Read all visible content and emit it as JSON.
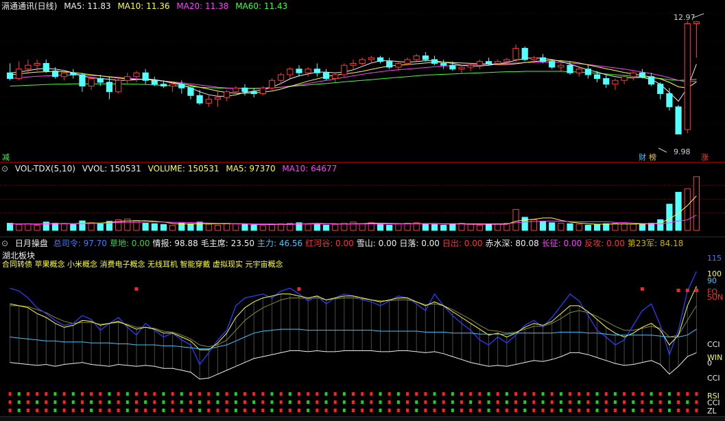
{
  "title_bar": {
    "stock": "滆通通讯(日线)",
    "ma5": "MA5: 11.83",
    "ma10": "MA10: 11.36",
    "ma20": "MA20: 11.38",
    "ma60": "MA60: 11.43"
  },
  "price_panel": {
    "high_label": "12.97",
    "low_label": "9.98",
    "left_marker": "减",
    "marker_cai": "财",
    "marker_bang": "榜",
    "marker_zhang": "涨"
  },
  "volume_panel": {
    "indicator": "VOL-TDX(5,10)",
    "vvol": "VVOL: 150531",
    "volume": "VOLUME: 150531",
    "ma5": "MA5: 97370",
    "ma10": "MA10: 64677"
  },
  "indicator_panel": {
    "name": "日月操盘",
    "fields": [
      {
        "text": "总司令: 97.70",
        "color": "#3f7fff"
      },
      {
        "text": "草地: 0.00",
        "color": "#3fd13f"
      },
      {
        "text": "情报: 98.88",
        "color": "#f0f0f0"
      },
      {
        "text": "毛主席: 23.50",
        "color": "#f0f0f0"
      },
      {
        "text": "主力: 46.56",
        "color": "#40c8ff"
      },
      {
        "text": "红河谷: 0.00",
        "color": "#ff3030"
      },
      {
        "text": "雪山: 0.00",
        "color": "#f0f0f0"
      },
      {
        "text": "日落: 0.00",
        "color": "#f0f0f0"
      },
      {
        "text": "日出: 0.00",
        "color": "#ff3030"
      },
      {
        "text": "赤水深: 80.08",
        "color": "#f0f0f0"
      },
      {
        "text": "长征: 0.00",
        "color": "#ff40ff"
      },
      {
        "text": "反攻: 0.00",
        "color": "#ff3030"
      },
      {
        "text": "第23军: 84.18",
        "color": "#c8b400"
      }
    ],
    "sector": "湖北板块",
    "concepts": "合同转债 苹果概念 小米概念 消费电子概念 无线耳机 智能穿戴 虚拟现实 元宇宙概念",
    "right_labels": [
      {
        "text": "115",
        "color": "#3f7fff"
      },
      {
        "text": "100",
        "color": "#ffff40"
      },
      {
        "text": "90",
        "color": "#40c8ff"
      },
      {
        "text": "FQ",
        "color": "#ff3030"
      },
      {
        "text": "SUN",
        "color": "#ff3030"
      },
      {
        "text": "CCI",
        "color": "#f0f0f0"
      },
      {
        "text": "WIN",
        "color": "#ffff40"
      },
      {
        "text": "0",
        "color": "#f0f0f0"
      },
      {
        "text": "CCI",
        "color": "#f0f0f0"
      },
      {
        "text": "RSI",
        "color": "#ffff40"
      },
      {
        "text": "CCI",
        "color": "#f0f0f0"
      },
      {
        "text": "ZL",
        "color": "#f0f0f0"
      }
    ]
  },
  "colors": {
    "up": "#ff3c3c",
    "down": "#54ffff",
    "ma5": "#f0f0f0",
    "ma10": "#ffff40",
    "ma20": "#ff40ff",
    "ma60": "#40ff40",
    "grid": "#8b0000"
  },
  "chart_data": {
    "type": "candlestick",
    "y_range_price": [
      9.5,
      13.2
    ],
    "ohlc": [
      [
        11.6,
        11.85,
        11.45,
        11.4
      ],
      [
        11.45,
        11.9,
        11.7,
        11.4
      ],
      [
        11.7,
        11.95,
        11.8,
        11.6
      ],
      [
        11.8,
        11.95,
        11.85,
        11.65
      ],
      [
        11.85,
        11.95,
        11.65,
        11.6
      ],
      [
        11.65,
        11.75,
        11.5,
        11.45
      ],
      [
        11.5,
        11.65,
        11.6,
        11.4
      ],
      [
        11.6,
        11.7,
        11.55,
        11.45
      ],
      [
        11.55,
        11.6,
        11.25,
        11.1
      ],
      [
        11.25,
        11.5,
        11.45,
        11.15
      ],
      [
        11.45,
        11.55,
        11.35,
        11.25
      ],
      [
        11.35,
        11.5,
        11.1,
        10.9
      ],
      [
        11.1,
        11.5,
        11.4,
        11.05
      ],
      [
        11.4,
        11.6,
        11.5,
        11.3
      ],
      [
        11.5,
        11.65,
        11.6,
        11.35
      ],
      [
        11.6,
        11.7,
        11.4,
        11.3
      ],
      [
        11.4,
        11.5,
        11.3,
        11.25
      ],
      [
        11.3,
        11.4,
        11.25,
        11.2
      ],
      [
        11.25,
        11.35,
        11.3,
        11.1
      ],
      [
        11.3,
        11.4,
        11.2,
        11.05
      ],
      [
        11.2,
        11.25,
        11.0,
        10.9
      ],
      [
        11.0,
        11.15,
        10.8,
        10.75
      ],
      [
        10.8,
        11.0,
        10.9,
        10.7
      ],
      [
        10.9,
        11.1,
        10.95,
        10.7
      ],
      [
        10.95,
        11.15,
        11.1,
        10.85
      ],
      [
        11.1,
        11.25,
        11.2,
        11.05
      ],
      [
        11.2,
        11.3,
        11.1,
        11.0
      ],
      [
        11.1,
        11.2,
        11.05,
        10.95
      ],
      [
        11.05,
        11.25,
        11.2,
        11.0
      ],
      [
        11.2,
        11.45,
        11.4,
        11.15
      ],
      [
        11.4,
        11.6,
        11.55,
        11.3
      ],
      [
        11.55,
        11.75,
        11.7,
        11.45
      ],
      [
        11.7,
        11.8,
        11.6,
        11.5
      ],
      [
        11.6,
        11.75,
        11.7,
        11.5
      ],
      [
        11.7,
        11.85,
        11.6,
        11.5
      ],
      [
        11.6,
        11.7,
        11.45,
        11.4
      ],
      [
        11.45,
        11.6,
        11.55,
        11.35
      ],
      [
        11.55,
        11.85,
        11.8,
        11.5
      ],
      [
        11.8,
        11.95,
        11.85,
        11.7
      ],
      [
        11.85,
        12.0,
        11.95,
        11.8
      ],
      [
        11.95,
        12.05,
        12.0,
        11.85
      ],
      [
        12.0,
        12.05,
        11.9,
        11.85
      ],
      [
        11.9,
        12.0,
        11.75,
        11.7
      ],
      [
        11.75,
        11.9,
        11.85,
        11.65
      ],
      [
        11.85,
        12.0,
        11.95,
        11.8
      ],
      [
        11.95,
        12.1,
        12.05,
        11.9
      ],
      [
        12.05,
        12.15,
        11.95,
        11.9
      ],
      [
        11.95,
        12.05,
        11.85,
        11.8
      ],
      [
        11.85,
        11.95,
        11.8,
        11.7
      ],
      [
        11.8,
        11.9,
        11.7,
        11.65
      ],
      [
        11.7,
        11.8,
        11.75,
        11.6
      ],
      [
        11.75,
        11.85,
        11.8,
        11.65
      ],
      [
        11.8,
        11.95,
        11.9,
        11.7
      ],
      [
        11.9,
        12.0,
        11.85,
        11.8
      ],
      [
        11.85,
        11.95,
        11.9,
        11.8
      ],
      [
        11.9,
        12.0,
        11.95,
        11.8
      ],
      [
        11.95,
        12.35,
        12.25,
        11.9
      ],
      [
        12.25,
        12.3,
        11.95,
        11.9
      ],
      [
        11.95,
        12.05,
        12.0,
        11.85
      ],
      [
        12.0,
        12.1,
        11.9,
        11.85
      ],
      [
        11.9,
        11.95,
        11.75,
        11.7
      ],
      [
        11.75,
        11.85,
        11.8,
        11.65
      ],
      [
        11.8,
        11.9,
        11.6,
        11.55
      ],
      [
        11.6,
        11.75,
        11.7,
        11.5
      ],
      [
        11.7,
        11.8,
        11.55,
        11.45
      ],
      [
        11.55,
        11.65,
        11.45,
        11.35
      ],
      [
        11.45,
        11.55,
        11.3,
        11.2
      ],
      [
        11.3,
        11.45,
        11.4,
        11.15
      ],
      [
        11.4,
        11.55,
        11.5,
        11.3
      ],
      [
        11.5,
        11.65,
        11.6,
        11.4
      ],
      [
        11.6,
        11.7,
        11.5,
        11.45
      ],
      [
        11.5,
        11.6,
        11.3,
        11.25
      ],
      [
        11.3,
        11.35,
        11.05,
        10.9
      ],
      [
        11.05,
        11.2,
        10.7,
        10.6
      ],
      [
        10.7,
        10.75,
        9.98,
        9.98
      ],
      [
        10.1,
        12.97,
        12.9,
        10.0
      ],
      [
        12.9,
        12.97,
        12.95,
        12.0
      ]
    ],
    "ma5_line": [
      11.6,
      11.62,
      11.66,
      11.7,
      11.72,
      11.7,
      11.66,
      11.6,
      11.52,
      11.47,
      11.45,
      11.43,
      11.4,
      11.4,
      11.42,
      11.44,
      11.42,
      11.38,
      11.33,
      11.28,
      11.2,
      11.1,
      11.02,
      10.98,
      10.98,
      11.02,
      11.08,
      11.12,
      11.15,
      11.22,
      11.32,
      11.44,
      11.52,
      11.57,
      11.62,
      11.62,
      11.6,
      11.62,
      11.68,
      11.77,
      11.86,
      11.92,
      11.92,
      11.9,
      11.88,
      11.9,
      11.92,
      11.92,
      11.88,
      11.85,
      11.8,
      11.78,
      11.78,
      11.8,
      11.84,
      11.87,
      11.93,
      11.98,
      12.0,
      11.98,
      11.95,
      11.9,
      11.83,
      11.75,
      11.68,
      11.62,
      11.55,
      11.5,
      11.47,
      11.47,
      11.48,
      11.42,
      11.3,
      11.08,
      10.85,
      11.2,
      11.83
    ],
    "ma10_line": [
      11.55,
      11.57,
      11.6,
      11.62,
      11.63,
      11.64,
      11.63,
      11.61,
      11.58,
      11.55,
      11.52,
      11.49,
      11.46,
      11.44,
      11.43,
      11.43,
      11.41,
      11.38,
      11.35,
      11.31,
      11.27,
      11.22,
      11.17,
      11.12,
      11.08,
      11.06,
      11.06,
      11.07,
      11.09,
      11.12,
      11.17,
      11.24,
      11.31,
      11.38,
      11.44,
      11.5,
      11.54,
      11.57,
      11.6,
      11.64,
      11.69,
      11.74,
      11.78,
      11.8,
      11.82,
      11.84,
      11.86,
      11.88,
      11.88,
      11.87,
      11.86,
      11.85,
      11.84,
      11.83,
      11.82,
      11.82,
      11.84,
      11.87,
      11.9,
      11.92,
      11.93,
      11.92,
      11.9,
      11.86,
      11.81,
      11.76,
      11.71,
      11.66,
      11.61,
      11.57,
      11.53,
      11.49,
      11.44,
      11.35,
      11.23,
      11.2,
      11.36
    ],
    "ma20_line": [
      11.45,
      11.47,
      11.49,
      11.51,
      11.52,
      11.53,
      11.54,
      11.54,
      11.54,
      11.53,
      11.52,
      11.5,
      11.48,
      11.46,
      11.44,
      11.42,
      11.4,
      11.38,
      11.36,
      11.34,
      11.31,
      11.28,
      11.25,
      11.22,
      11.2,
      11.19,
      11.18,
      11.18,
      11.19,
      11.2,
      11.22,
      11.25,
      11.28,
      11.32,
      11.36,
      11.4,
      11.44,
      11.48,
      11.52,
      11.56,
      11.6,
      11.63,
      11.66,
      11.68,
      11.7,
      11.72,
      11.74,
      11.76,
      11.78,
      11.79,
      11.8,
      11.81,
      11.82,
      11.83,
      11.84,
      11.85,
      11.86,
      11.87,
      11.88,
      11.88,
      11.88,
      11.87,
      11.86,
      11.84,
      11.82,
      11.79,
      11.76,
      11.73,
      11.7,
      11.66,
      11.62,
      11.58,
      11.53,
      11.47,
      11.4,
      11.36,
      11.38
    ],
    "ma60_line": [
      11.25,
      11.26,
      11.27,
      11.28,
      11.29,
      11.3,
      11.3,
      11.31,
      11.31,
      11.31,
      11.31,
      11.31,
      11.31,
      11.3,
      11.3,
      11.29,
      11.28,
      11.27,
      11.26,
      11.25,
      11.24,
      11.22,
      11.21,
      11.2,
      11.19,
      11.19,
      11.19,
      11.19,
      11.2,
      11.21,
      11.22,
      11.24,
      11.26,
      11.28,
      11.3,
      11.32,
      11.34,
      11.36,
      11.38,
      11.4,
      11.42,
      11.44,
      11.46,
      11.48,
      11.5,
      11.52,
      11.54,
      11.55,
      11.56,
      11.57,
      11.58,
      11.59,
      11.6,
      11.61,
      11.62,
      11.63,
      11.63,
      11.64,
      11.64,
      11.64,
      11.64,
      11.64,
      11.63,
      11.62,
      11.61,
      11.59,
      11.57,
      11.55,
      11.53,
      11.51,
      11.49,
      11.47,
      11.45,
      11.42,
      11.4,
      11.41,
      11.43
    ],
    "volume": [
      30,
      25,
      28,
      22,
      35,
      30,
      28,
      25,
      40,
      32,
      28,
      38,
      45,
      48,
      42,
      30,
      28,
      25,
      22,
      30,
      28,
      35,
      26,
      22,
      30,
      28,
      25,
      22,
      20,
      25,
      28,
      30,
      32,
      26,
      28,
      22,
      25,
      30,
      35,
      28,
      32,
      26,
      22,
      28,
      30,
      32,
      28,
      25,
      22,
      28,
      30,
      26,
      22,
      24,
      26,
      30,
      88,
      55,
      45,
      38,
      32,
      30,
      28,
      26,
      22,
      25,
      28,
      30,
      28,
      26,
      25,
      30,
      45,
      110,
      160,
      175,
      225
    ],
    "vol_ma5_line": [
      28,
      27,
      27,
      26,
      28,
      28,
      29,
      28,
      31,
      31,
      31,
      33,
      37,
      40,
      40,
      41,
      38,
      35,
      29,
      27,
      27,
      28,
      28,
      28,
      28,
      28,
      28,
      25,
      25,
      25,
      25,
      25,
      27,
      28,
      29,
      28,
      28,
      26,
      28,
      28,
      30,
      30,
      29,
      28,
      28,
      28,
      28,
      29,
      27,
      27,
      27,
      26,
      26,
      26,
      26,
      26,
      38,
      44,
      47,
      52,
      52,
      42,
      35,
      31,
      28,
      26,
      26,
      27,
      27,
      27,
      27,
      28,
      31,
      48,
      72,
      104,
      145
    ],
    "vol_ma10_line": [
      27,
      27,
      27,
      27,
      27,
      28,
      28,
      28,
      29,
      29,
      30,
      31,
      33,
      34,
      34,
      35,
      35,
      35,
      34,
      34,
      33,
      32,
      31,
      30,
      30,
      28,
      28,
      27,
      27,
      27,
      26,
      27,
      27,
      27,
      27,
      27,
      27,
      26,
      27,
      27,
      27,
      27,
      27,
      27,
      28,
      28,
      28,
      28,
      28,
      28,
      28,
      28,
      28,
      28,
      28,
      28,
      32,
      35,
      37,
      39,
      39,
      38,
      37,
      36,
      36,
      36,
      36,
      34,
      33,
      31,
      29,
      28,
      28,
      32,
      39,
      44,
      64
    ],
    "ind_blue": [
      98,
      95,
      88,
      78,
      72,
      65,
      60,
      62,
      70,
      66,
      55,
      62,
      68,
      58,
      50,
      62,
      55,
      48,
      52,
      45,
      40,
      20,
      32,
      45,
      55,
      80,
      88,
      90,
      92,
      88,
      95,
      98,
      92,
      85,
      90,
      82,
      88,
      92,
      90,
      86,
      84,
      80,
      85,
      90,
      88,
      82,
      75,
      92,
      80,
      70,
      62,
      55,
      45,
      40,
      48,
      42,
      50,
      60,
      65,
      58,
      68,
      80,
      92,
      85,
      70,
      55,
      48,
      40,
      45,
      60,
      75,
      82,
      60,
      30,
      55,
      95,
      115
    ],
    "ind_yellow": [
      82,
      80,
      78,
      72,
      68,
      62,
      58,
      60,
      65,
      64,
      60,
      62,
      64,
      60,
      56,
      58,
      56,
      52,
      52,
      48,
      44,
      35,
      35,
      42,
      52,
      68,
      78,
      84,
      88,
      90,
      92,
      92,
      90,
      88,
      90,
      86,
      88,
      90,
      90,
      88,
      86,
      84,
      86,
      88,
      88,
      84,
      80,
      84,
      80,
      74,
      68,
      62,
      56,
      50,
      52,
      48,
      52,
      58,
      62,
      60,
      64,
      72,
      80,
      80,
      74,
      66,
      58,
      52,
      48,
      52,
      58,
      62,
      55,
      40,
      50,
      80,
      100
    ],
    "ind_cyan": [
      48,
      47,
      46,
      45,
      44,
      44,
      43,
      43,
      43,
      42,
      42,
      42,
      41,
      41,
      40,
      40,
      40,
      39,
      39,
      38,
      37,
      36,
      36,
      38,
      40,
      44,
      48,
      52,
      54,
      55,
      56,
      56,
      56,
      55,
      55,
      55,
      55,
      55,
      55,
      55,
      55,
      54,
      54,
      54,
      54,
      54,
      53,
      53,
      53,
      52,
      52,
      52,
      51,
      51,
      51,
      51,
      52,
      52,
      52,
      52,
      52,
      53,
      53,
      53,
      52,
      52,
      51,
      50,
      50,
      50,
      50,
      50,
      49,
      48,
      48,
      50,
      56
    ],
    "ind_white": [
      22,
      21,
      20,
      19,
      20,
      18,
      20,
      21,
      22,
      20,
      19,
      18,
      20,
      19,
      18,
      19,
      18,
      16,
      16,
      14,
      12,
      5,
      6,
      10,
      14,
      18,
      22,
      26,
      28,
      30,
      32,
      34,
      34,
      33,
      34,
      33,
      33,
      34,
      34,
      34,
      34,
      33,
      33,
      34,
      34,
      33,
      32,
      33,
      31,
      28,
      25,
      22,
      20,
      18,
      19,
      18,
      20,
      22,
      24,
      23,
      25,
      28,
      32,
      32,
      30,
      27,
      24,
      21,
      19,
      20,
      22,
      24,
      20,
      10,
      18,
      28,
      32
    ],
    "ind_olive": [
      80,
      80,
      79,
      76,
      73,
      68,
      64,
      62,
      63,
      63,
      61,
      62,
      63,
      61,
      58,
      58,
      57,
      54,
      53,
      50,
      46,
      40,
      38,
      40,
      45,
      55,
      65,
      72,
      78,
      82,
      86,
      88,
      88,
      87,
      88,
      86,
      87,
      88,
      88,
      87,
      86,
      85,
      85,
      86,
      86,
      84,
      81,
      82,
      80,
      76,
      71,
      66,
      60,
      55,
      54,
      52,
      53,
      56,
      59,
      59,
      62,
      67,
      73,
      75,
      73,
      69,
      64,
      59,
      55,
      55,
      57,
      59,
      57,
      48,
      50,
      65,
      80
    ]
  }
}
